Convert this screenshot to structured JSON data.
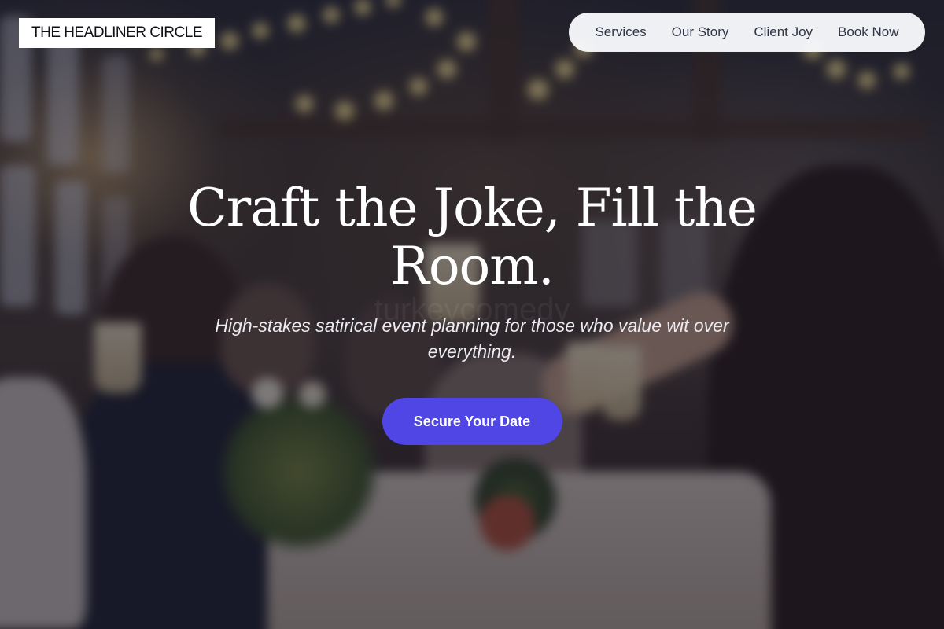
{
  "header": {
    "brand": "THE HEADLINER CIRCLE",
    "nav": [
      {
        "label": "Services"
      },
      {
        "label": "Our Story"
      },
      {
        "label": "Client Joy"
      },
      {
        "label": "Book Now"
      }
    ]
  },
  "hero": {
    "title_line1": "Craft the Joke, Fill the",
    "title_line2": "Room.",
    "subtitle": "High-stakes satirical event planning for those who value wit over everything.",
    "cta_label": "Secure Your Date",
    "watermark": "turkeycomedy"
  },
  "colors": {
    "accent": "#4f46e5",
    "overlay": "#121020",
    "nav_bg": "#f8f9fc",
    "text_light": "#ffffff"
  },
  "background_image": "blurred photo of guests raising champagne glasses at a banquet under string lights"
}
